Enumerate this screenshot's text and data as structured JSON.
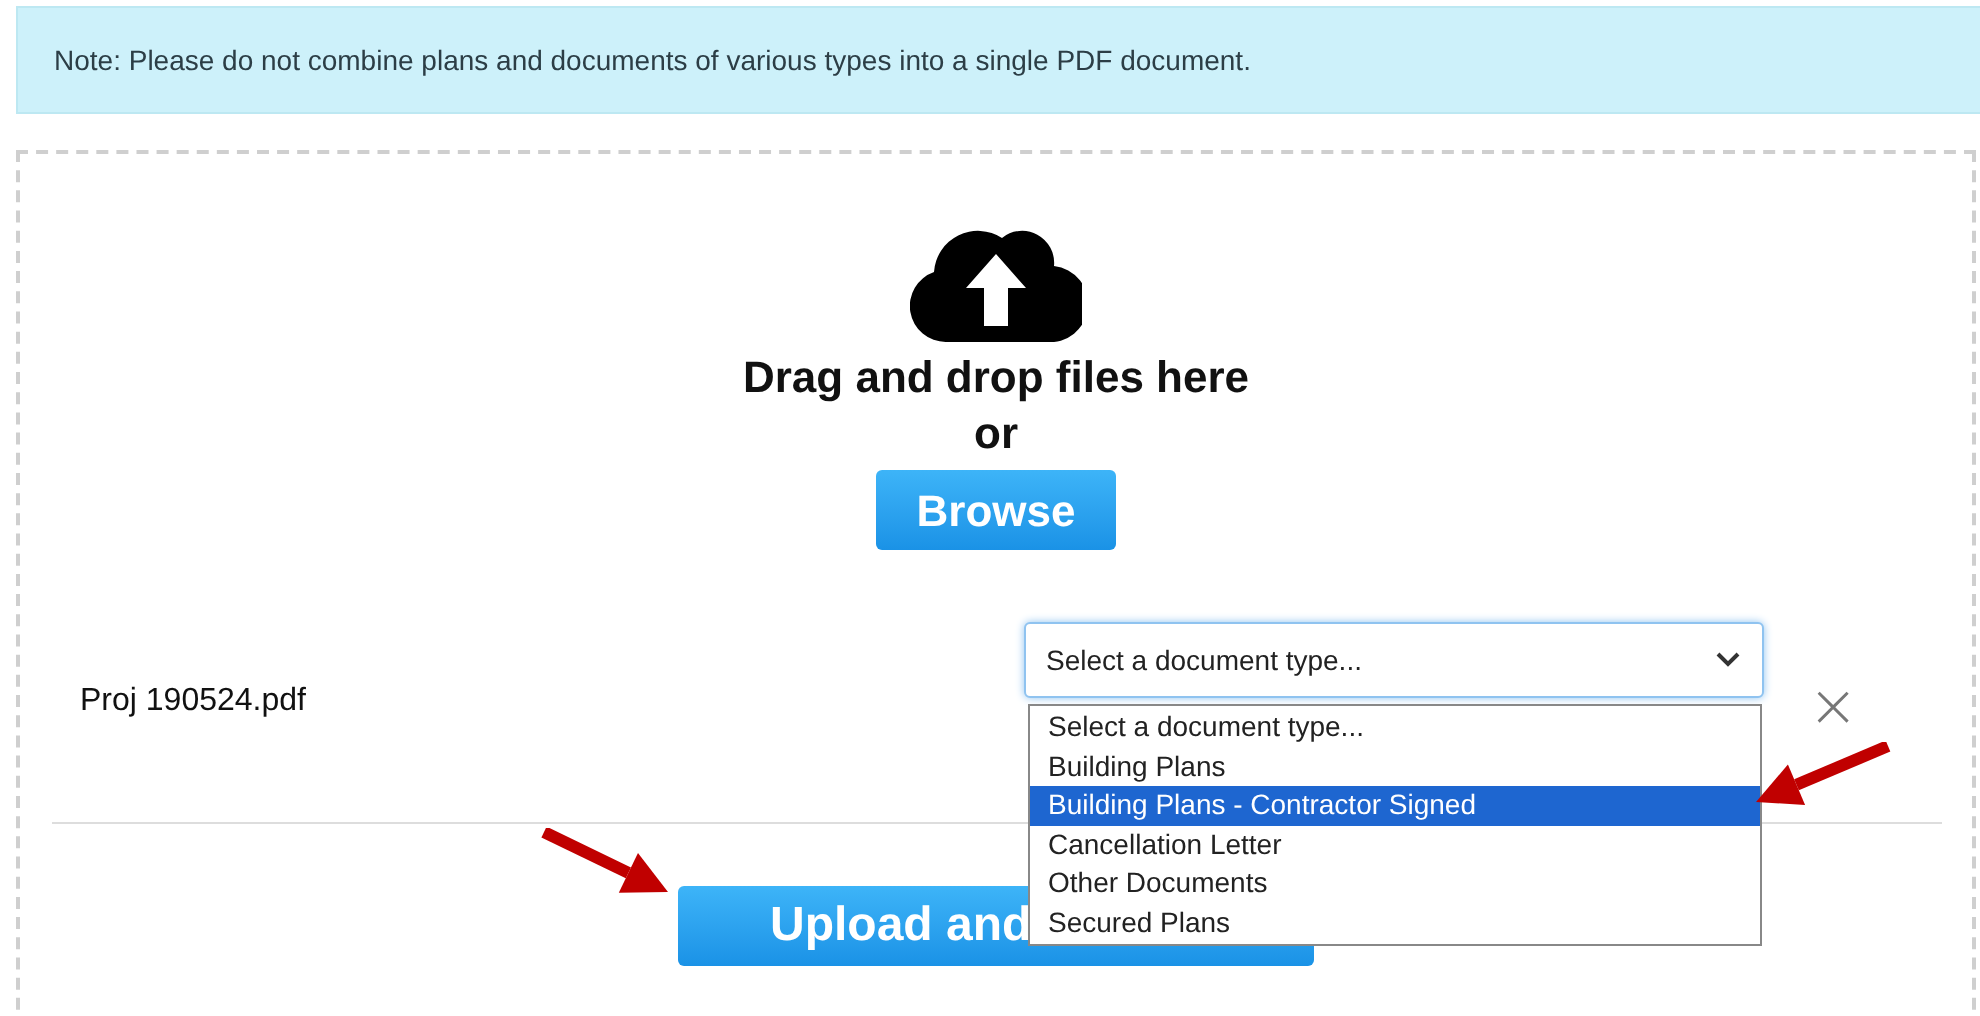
{
  "note": "Note: Please do not combine plans and documents of various types into a single PDF document.",
  "dropzone": {
    "heading": "Drag and drop files here",
    "or": "or",
    "browse_button": "Browse"
  },
  "file": {
    "name": "Proj 190524.pdf",
    "remove": "×"
  },
  "document_type": {
    "value": "Select a document type...",
    "expanded": true,
    "options": [
      {
        "label": "Select a document type...",
        "highlighted": false
      },
      {
        "label": "Building Plans",
        "highlighted": false
      },
      {
        "label": "Building Plans - Contractor Signed",
        "highlighted": true
      },
      {
        "label": "Cancellation Letter",
        "highlighted": false
      },
      {
        "label": "Other Documents",
        "highlighted": false
      },
      {
        "label": "Secured Plans",
        "highlighted": false
      }
    ]
  },
  "upload_button": "Upload and"
}
